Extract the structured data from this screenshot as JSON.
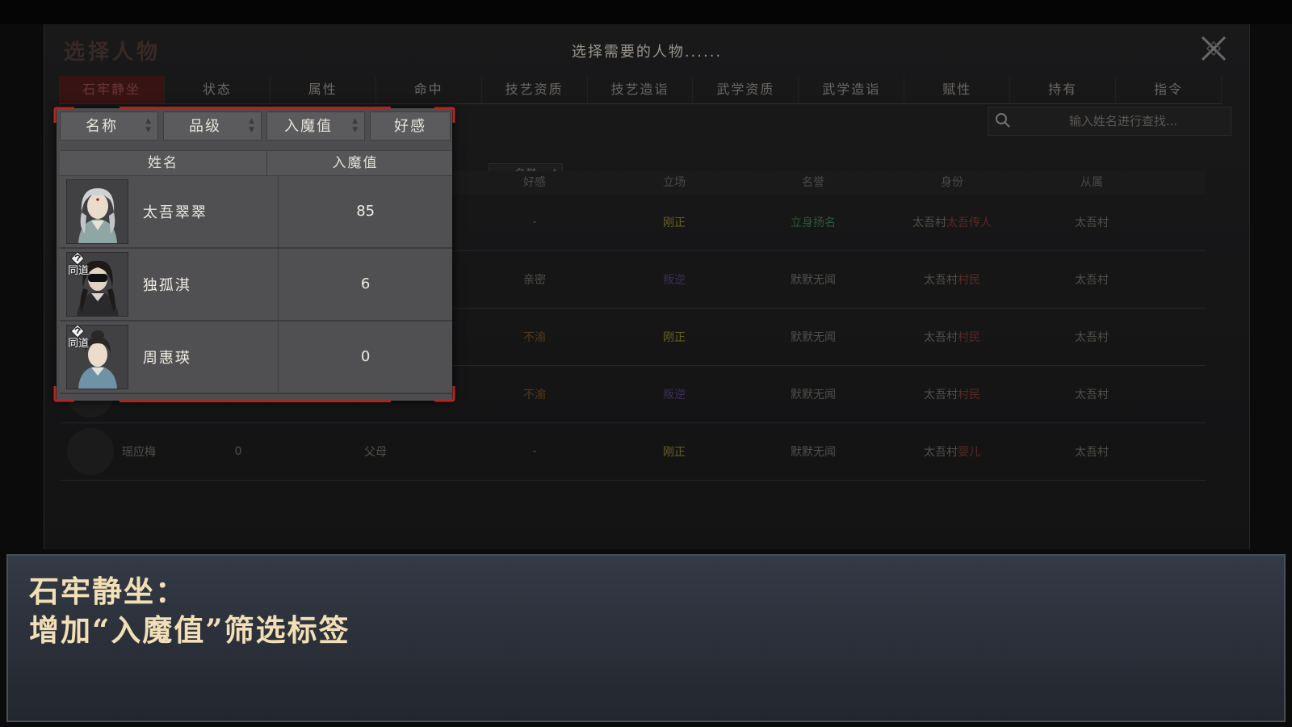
{
  "window": {
    "title": "选择人物",
    "prompt": "选择需要的人物......",
    "close_icon": "close-x-icon"
  },
  "tabs": [
    {
      "label": "石牢静坐",
      "active": true
    },
    {
      "label": "状态"
    },
    {
      "label": "属性"
    },
    {
      "label": "命中"
    },
    {
      "label": "技艺资质"
    },
    {
      "label": "技艺造诣"
    },
    {
      "label": "武学资质"
    },
    {
      "label": "武学造诣"
    },
    {
      "label": "赋性"
    },
    {
      "label": "持有"
    },
    {
      "label": "指令"
    }
  ],
  "search": {
    "placeholder": "输入姓名进行查找..."
  },
  "bg_sort_chip": {
    "label": "名誉"
  },
  "bg_table": {
    "headers": [
      "好感",
      "立场",
      "名誉",
      "身份",
      "从属"
    ],
    "rows": [
      {
        "name": "",
        "value": "",
        "relation": "",
        "favor": "-",
        "stance": "刚正",
        "fame": "立身扬名",
        "identity_a": "太吾村",
        "identity_b": "太吾传人",
        "affiliation": "太吾村"
      },
      {
        "name": "",
        "value": "",
        "relation": "",
        "favor": "亲密",
        "stance": "叛逆",
        "fame": "默默无闻",
        "identity_a": "太吾村",
        "identity_b": "村民",
        "affiliation": "太吾村"
      },
      {
        "name": "",
        "value": "",
        "relation": "",
        "favor": "不渝",
        "stance": "刚正",
        "fame": "默默无闻",
        "identity_a": "太吾村",
        "identity_b": "村民",
        "affiliation": "太吾村"
      },
      {
        "name": "",
        "value": "",
        "relation": "",
        "favor": "不渝",
        "stance": "叛逆",
        "fame": "默默无闻",
        "identity_a": "太吾村",
        "identity_b": "村民",
        "affiliation": "太吾村"
      },
      {
        "name": "瑶应梅",
        "value": "0",
        "relation": "父母",
        "favor": "-",
        "stance": "刚正",
        "fame": "默默无闻",
        "identity_a": "太吾村",
        "identity_b": "婴儿",
        "affiliation": "太吾村"
      }
    ]
  },
  "popup": {
    "filters": [
      "名称",
      "品级",
      "入魔值",
      "好感"
    ],
    "header": {
      "name": "姓名",
      "value": "入魔值"
    },
    "badge_label": "同道",
    "rows": [
      {
        "name": "太吾翠翠",
        "value": "85",
        "badge": false
      },
      {
        "name": "独孤淇",
        "value": "6",
        "badge": true
      },
      {
        "name": "周惠瑛",
        "value": "0",
        "badge": true
      }
    ]
  },
  "caption": {
    "line1": "石牢静坐：",
    "line2": "增加“入魔值”筛选标签"
  },
  "colors": {
    "accent_red": "#a12a22",
    "caption_text": "#f3dfb6",
    "stance_upright": "#6a6520",
    "stance_rebel": "#3e2f55"
  }
}
